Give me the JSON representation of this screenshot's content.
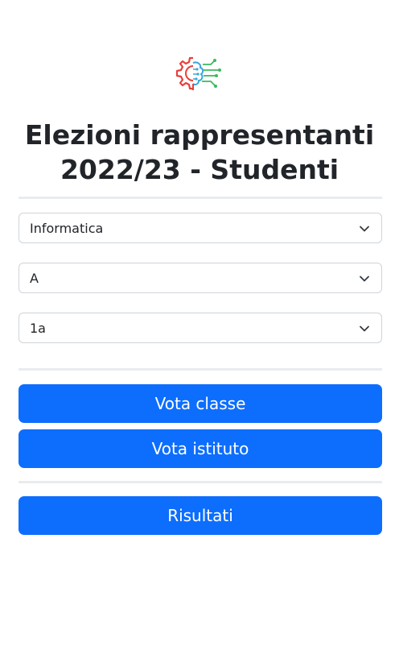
{
  "header": {
    "logo_icon": "brain-circuit-gear-icon",
    "title_line1": "Elezioni rappresentanti",
    "title_line2": "2022/23 - Studenti"
  },
  "form": {
    "selects": [
      {
        "name": "indirizzo",
        "value": "Informatica"
      },
      {
        "name": "sezione",
        "value": "A"
      },
      {
        "name": "classe",
        "value": "1a"
      }
    ]
  },
  "actions": {
    "vota_classe_label": "Vota classe",
    "vota_istituto_label": "Vota istituto",
    "risultati_label": "Risultati"
  },
  "colors": {
    "primary": "#0d6efd",
    "divider": "#e9ecef",
    "border": "#ced4da",
    "logo_red": "#e8403a",
    "logo_blue": "#3aa8d8",
    "logo_green": "#3fb85f"
  }
}
